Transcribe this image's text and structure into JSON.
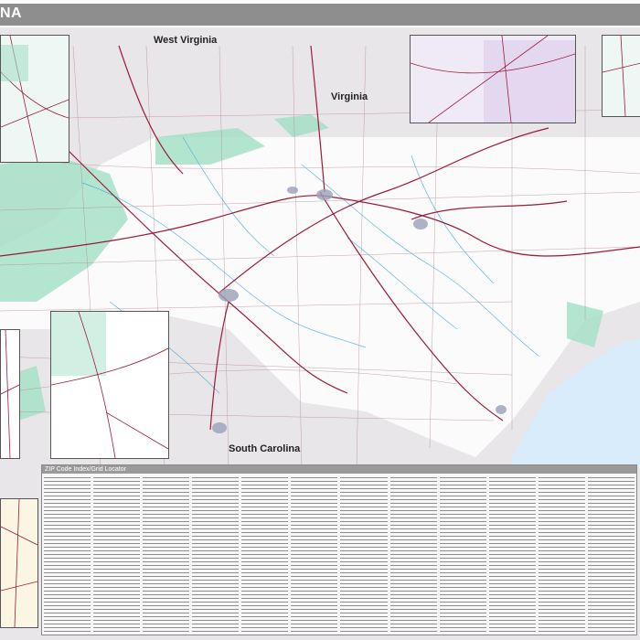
{
  "map": {
    "title": "NA",
    "labels": {
      "west_virginia": "West Virginia",
      "virginia": "Virginia",
      "south_carolina": "South Carolina"
    },
    "index_title": "ZIP Code Index/Grid Locator",
    "colors": {
      "title_bar": "#8e8e8e",
      "road_major": "#9b1b3a",
      "road_minor": "#b08594",
      "water": "#3aa5d8",
      "forest": "#9bdcc2",
      "ocean": "#d9ecfb",
      "land_out": "#e9e6e9",
      "land_nc": "#fbfbfb"
    }
  }
}
